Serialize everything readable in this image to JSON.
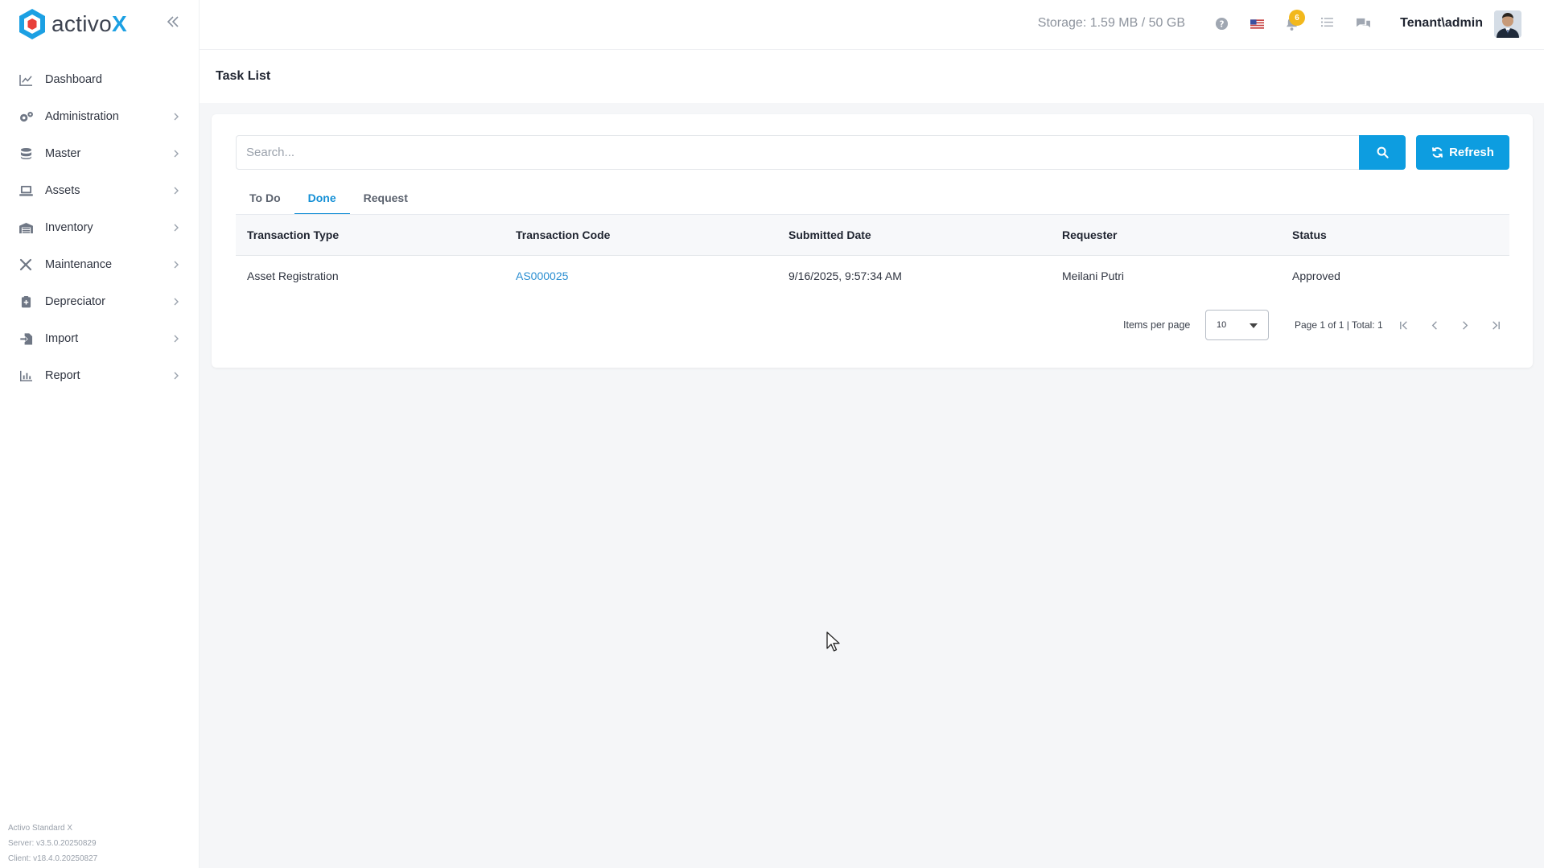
{
  "brand": {
    "name_prefix": "activo",
    "name_suffix": "X"
  },
  "sidebar": {
    "items": [
      {
        "label": "Dashboard",
        "icon": "chart-line-icon",
        "has_children": false
      },
      {
        "label": "Administration",
        "icon": "gears-icon",
        "has_children": true
      },
      {
        "label": "Master",
        "icon": "database-icon",
        "has_children": true
      },
      {
        "label": "Assets",
        "icon": "laptop-icon",
        "has_children": true
      },
      {
        "label": "Inventory",
        "icon": "warehouse-icon",
        "has_children": true
      },
      {
        "label": "Maintenance",
        "icon": "tools-icon",
        "has_children": true
      },
      {
        "label": "Depreciator",
        "icon": "clipboard-icon",
        "has_children": true
      },
      {
        "label": "Import",
        "icon": "file-import-icon",
        "has_children": true
      },
      {
        "label": "Report",
        "icon": "chart-bar-icon",
        "has_children": true
      }
    ],
    "footer": {
      "product": "Activo Standard X",
      "server": "Server: v3.5.0.20250829",
      "client": "Client: v18.4.0.20250827"
    }
  },
  "header": {
    "storage": "Storage: 1.59 MB / 50 GB",
    "notification_count": "6",
    "user": "Tenant\\admin"
  },
  "page": {
    "title": "Task List"
  },
  "search": {
    "placeholder": "Search..."
  },
  "buttons": {
    "refresh": "Refresh"
  },
  "tabs": [
    {
      "label": "To Do",
      "active": false
    },
    {
      "label": "Done",
      "active": true
    },
    {
      "label": "Request",
      "active": false
    }
  ],
  "table": {
    "columns": [
      "Transaction Type",
      "Transaction Code",
      "Submitted Date",
      "Requester",
      "Status"
    ],
    "rows": [
      [
        "Asset Registration",
        "AS000025",
        "9/16/2025, 9:57:34 AM",
        "Meilani Putri",
        "Approved"
      ]
    ]
  },
  "pagination": {
    "items_per_page_label": "Items per page",
    "items_per_page": "10",
    "page_info": "Page 1 of 1 | Total: 1"
  },
  "colors": {
    "primary": "#0d9de0",
    "active_tab": "#1590d6",
    "link": "#2a8ed1",
    "badge": "#f2b81c"
  }
}
